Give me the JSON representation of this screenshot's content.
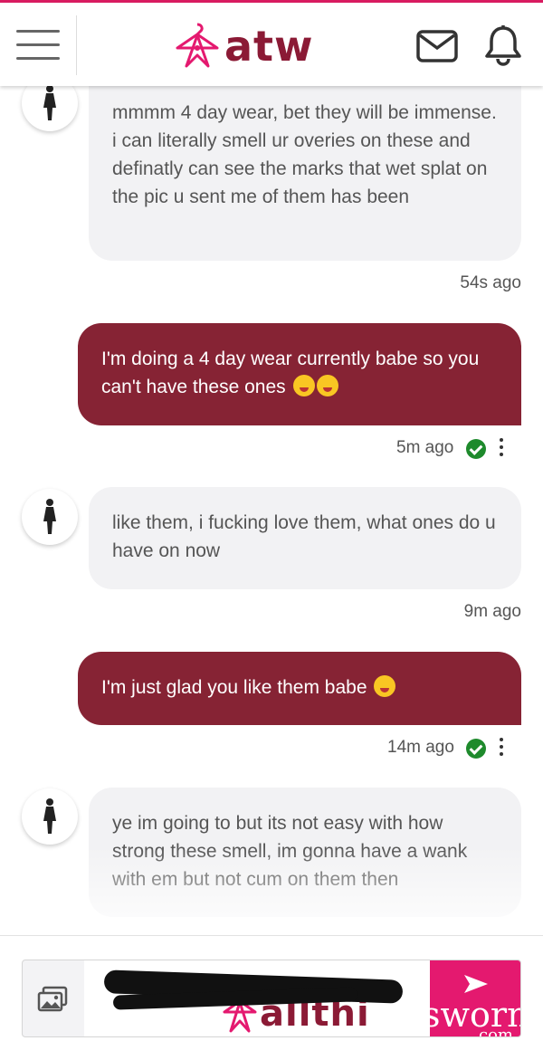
{
  "header": {
    "brand": "atw",
    "colors": {
      "brand": "#8b1a35",
      "accent": "#d81b60"
    },
    "icons": {
      "menu": "hamburger-icon",
      "mail": "envelope-icon",
      "notifications": "bell-icon",
      "logo": "hanger-icon"
    }
  },
  "messages": [
    {
      "direction": "incoming",
      "text": "mmmm 4 day wear, bet they will be immense. i can literally smell ur overies on these and definatly can see the marks that wet splat on the pic u sent me of them has been",
      "time": "54s ago"
    },
    {
      "direction": "outgoing",
      "text": "I'm doing a 4 day wear currently babe so you can't have these ones",
      "emojis": [
        "face-with-tears-of-joy",
        "face-blowing-a-kiss"
      ],
      "time": "5m ago",
      "read": true
    },
    {
      "direction": "incoming",
      "text": "like them, i fucking love them, what ones do u have on now",
      "time": "9m ago"
    },
    {
      "direction": "outgoing",
      "text": "I'm just glad you like them babe",
      "emojis": [
        "face-blowing-a-kiss"
      ],
      "time": "14m ago",
      "read": true
    },
    {
      "direction": "incoming",
      "text": "ye im going to but its not easy with how strong these smell, im gonna have a wank with em but not cum on them then",
      "time": ""
    }
  ],
  "composer": {
    "placeholder": "",
    "watermark": "allthi",
    "send_watermark": "sworn",
    "send_watermark_2": "com",
    "colors": {
      "send": "#e4196f",
      "outgoing_bubble": "#862334",
      "incoming_bubble": "#f2f2f4"
    }
  }
}
